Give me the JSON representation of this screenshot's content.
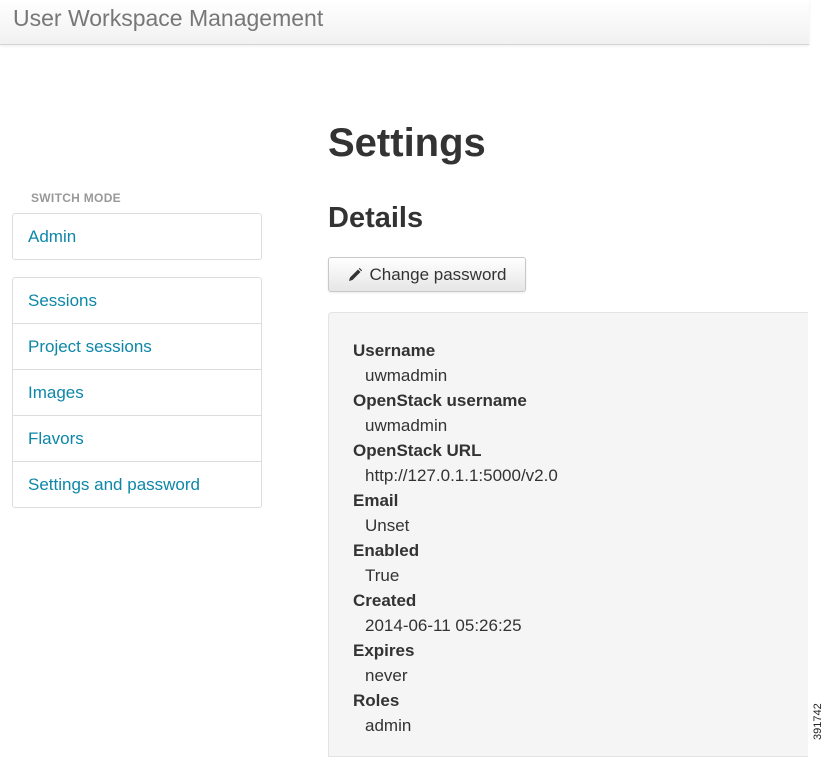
{
  "header": {
    "title": "User Workspace Management"
  },
  "sidebar": {
    "section_label": "SWITCH MODE",
    "mode_items": [
      {
        "label": "Admin"
      }
    ],
    "items": [
      {
        "label": "Sessions"
      },
      {
        "label": "Project sessions"
      },
      {
        "label": "Images"
      },
      {
        "label": "Flavors"
      },
      {
        "label": "Settings and password"
      }
    ]
  },
  "main": {
    "title": "Settings",
    "details_heading": "Details",
    "change_password_label": "Change password",
    "change_password_icon": "pencil-icon",
    "details": [
      {
        "label": "Username",
        "value": "uwmadmin"
      },
      {
        "label": "OpenStack username",
        "value": "uwmadmin"
      },
      {
        "label": "OpenStack URL",
        "value": "http://127.0.1.1:5000/v2.0"
      },
      {
        "label": "Email",
        "value": "Unset"
      },
      {
        "label": "Enabled",
        "value": "True"
      },
      {
        "label": "Created",
        "value": "2014-06-11 05:26:25"
      },
      {
        "label": "Expires",
        "value": "never"
      },
      {
        "label": "Roles",
        "value": "admin"
      }
    ]
  },
  "figure_id": "391742",
  "colors": {
    "link": "#0d87a7",
    "well_background": "#f5f5f5",
    "muted_text": "#999999"
  }
}
